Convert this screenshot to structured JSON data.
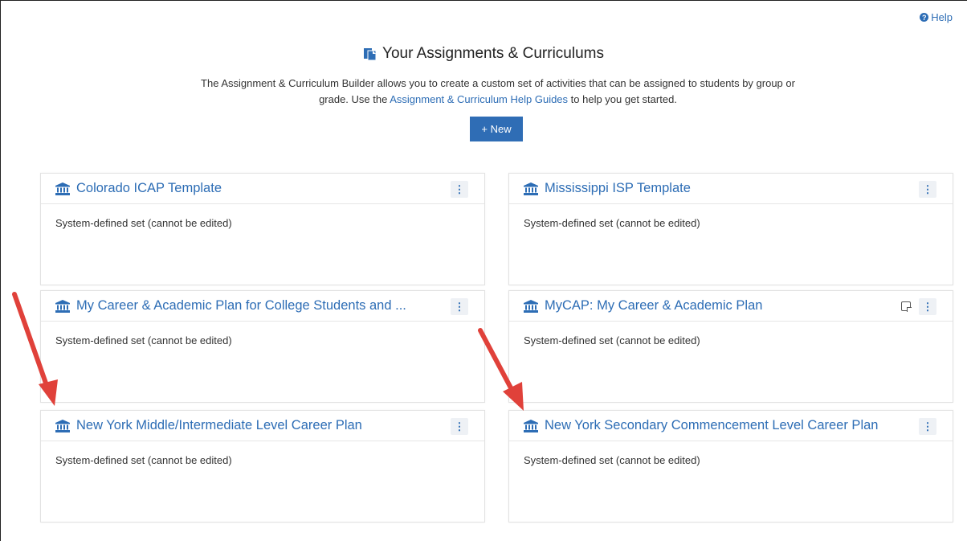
{
  "header": {
    "help_label": "Help",
    "title": "Your Assignments & Curriculums",
    "intro_before": "The Assignment & Curriculum Builder allows you to create a custom set of activities that can be assigned to students by group or grade. Use the ",
    "intro_link": "Assignment & Curriculum Help Guides",
    "intro_after": " to help you get started.",
    "new_button": "+ New"
  },
  "cards": [
    {
      "title": "Colorado ICAP Template",
      "body": "System-defined set (cannot be edited)"
    },
    {
      "title": "Mississippi ISP Template",
      "body": "System-defined set (cannot be edited)"
    },
    {
      "title": "My Career & Academic Plan for College Students and ...",
      "body": "System-defined set (cannot be edited)"
    },
    {
      "title": "MyCAP: My Career & Academic Plan",
      "body": "System-defined set (cannot be edited)"
    },
    {
      "title": "New York Middle/Intermediate Level Career Plan",
      "body": "System-defined set (cannot be edited)"
    },
    {
      "title": "New York Secondary Commencement Level Career Plan",
      "body": "System-defined set (cannot be edited)"
    }
  ],
  "menu_glyph": "⋮",
  "colors": {
    "link": "#2d6db5",
    "button": "#2f6db5",
    "annotation_arrow": "#e0413a"
  }
}
